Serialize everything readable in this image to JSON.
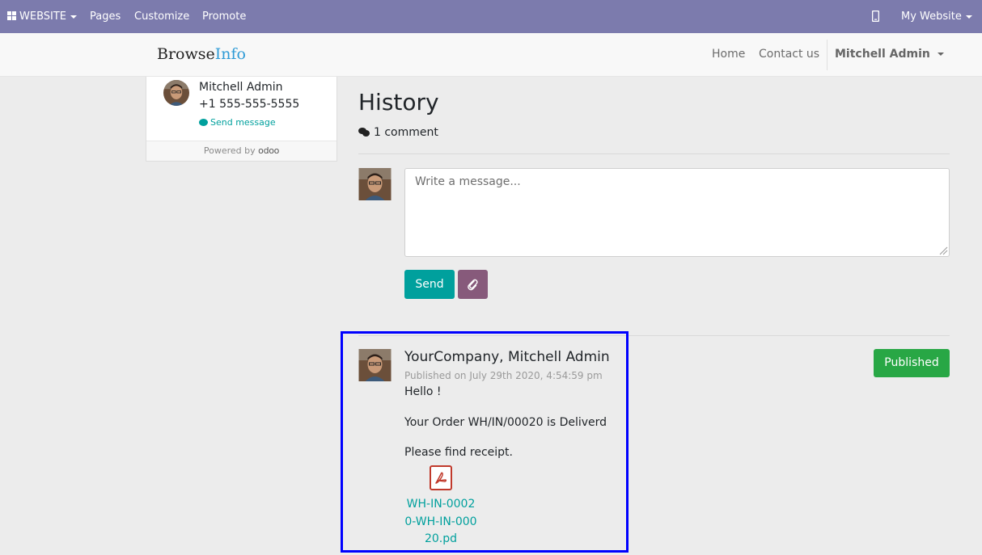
{
  "adminbar": {
    "website_label": "WEBSITE",
    "pages_label": "Pages",
    "customize_label": "Customize",
    "promote_label": "Promote",
    "my_website_label": "My Website"
  },
  "header": {
    "brand_main": "Browse",
    "brand_accent": "Info",
    "nav": {
      "home": "Home",
      "contact": "Contact us",
      "user": "Mitchell Admin"
    }
  },
  "sidebar": {
    "contact_name": "Mitchell Admin",
    "contact_phone": "+1 555-555-5555",
    "send_message": "Send message",
    "powered_by": "Powered by",
    "powered_logo": "odoo"
  },
  "history": {
    "title": "History",
    "comment_count": "1 comment",
    "composer": {
      "placeholder": "Write a message...",
      "send_label": "Send"
    }
  },
  "message": {
    "author": "YourCompany, Mitchell Admin",
    "date": "Published on July 29th 2020, 4:54:59 pm",
    "lines": [
      "Hello !",
      "Your Order WH/IN/00020 is Deliverd",
      "Please find receipt."
    ],
    "attachment_name": "WH-IN-00020-WH-IN-00020.pd",
    "status": "Published"
  },
  "colors": {
    "adminbar": "#7c7bad",
    "primary": "#00a09d",
    "attach_button": "#875a7b",
    "published": "#28a745",
    "highlight_border": "#0000ff"
  },
  "icons": [
    "apps-icon",
    "mobile-icon",
    "comment-icon",
    "comments-icon",
    "paperclip-icon",
    "pdf-file-icon"
  ]
}
